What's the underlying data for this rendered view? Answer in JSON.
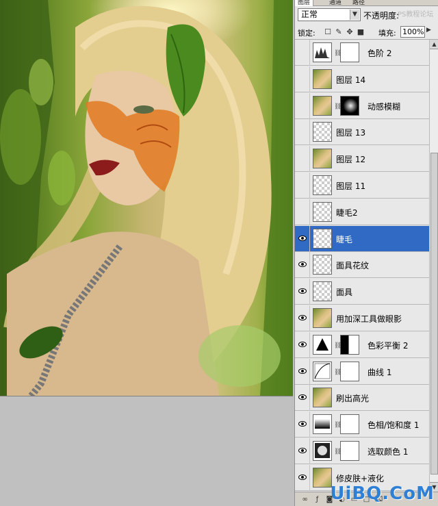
{
  "panel_tabs": [
    "图层",
    "通道",
    "路径"
  ],
  "blend_mode": "正常",
  "opacity_label": "不透明度:",
  "watermark": "PS教程论坛",
  "lock_label": "锁定:",
  "fill_label": "填充:",
  "fill_value": "100%",
  "layers": [
    {
      "name": "色阶 2",
      "visible": false,
      "thumb": "adjust-levels",
      "mask": "white",
      "selected": false
    },
    {
      "name": "图层 14",
      "visible": false,
      "thumb": "photo",
      "mask": null,
      "selected": false
    },
    {
      "name": "动感模糊",
      "visible": false,
      "thumb": "photo",
      "mask": "black",
      "selected": false
    },
    {
      "name": "图层 13",
      "visible": false,
      "thumb": "transparent",
      "mask": null,
      "selected": false
    },
    {
      "name": "图层 12",
      "visible": false,
      "thumb": "photo",
      "mask": null,
      "selected": false
    },
    {
      "name": "图层 11",
      "visible": false,
      "thumb": "transparent",
      "mask": null,
      "selected": false
    },
    {
      "name": "睫毛2",
      "visible": false,
      "thumb": "transparent",
      "mask": null,
      "selected": false
    },
    {
      "name": "睫毛",
      "visible": true,
      "thumb": "transparent",
      "mask": null,
      "selected": true
    },
    {
      "name": "面具花纹",
      "visible": true,
      "thumb": "transparent",
      "mask": null,
      "selected": false
    },
    {
      "name": "面具",
      "visible": true,
      "thumb": "transparent",
      "mask": null,
      "selected": false
    },
    {
      "name": "用加深工具做眼影",
      "visible": true,
      "thumb": "photo",
      "mask": null,
      "selected": false
    },
    {
      "name": "色彩平衡 2",
      "visible": true,
      "thumb": "adjust-balance",
      "mask": "shape",
      "selected": false
    },
    {
      "name": "曲线 1",
      "visible": true,
      "thumb": "adjust-curves",
      "mask": "white",
      "selected": false
    },
    {
      "name": "刷出高光",
      "visible": true,
      "thumb": "photo",
      "mask": null,
      "selected": false
    },
    {
      "name": "色相/饱和度 1",
      "visible": true,
      "thumb": "adjust-hue",
      "mask": "white",
      "selected": false
    },
    {
      "name": "选取颜色 1",
      "visible": true,
      "thumb": "adjust-selective",
      "mask": "white",
      "selected": false
    },
    {
      "name": "修皮肤+液化",
      "visible": true,
      "thumb": "photo",
      "mask": null,
      "selected": false
    }
  ],
  "site_logo": "UiBQ.CoM",
  "colors": {
    "selected_row": "#316ac5",
    "logo": "#2e7fd6"
  }
}
